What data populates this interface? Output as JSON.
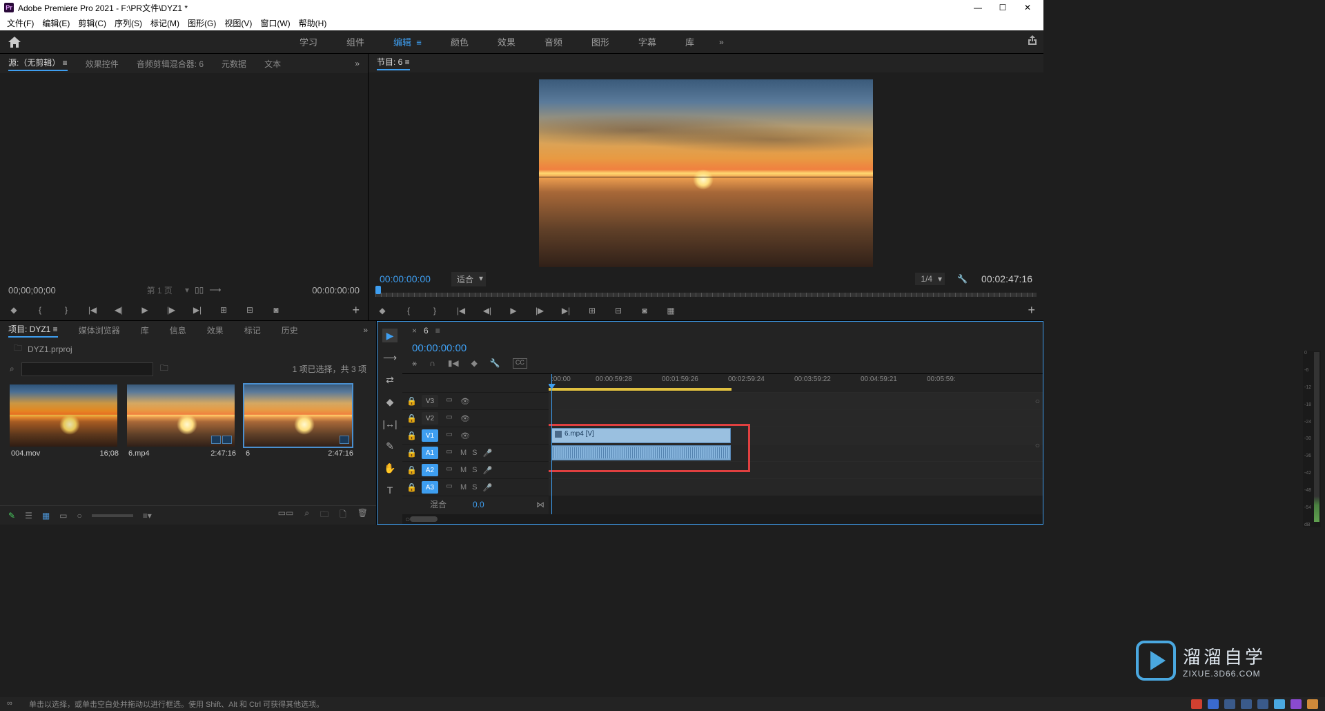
{
  "titlebar": {
    "app": "Adobe Premiere Pro 2021",
    "path": "F:\\PR文件\\DYZ1 *"
  },
  "menu": [
    "文件(F)",
    "编辑(E)",
    "剪辑(C)",
    "序列(S)",
    "标记(M)",
    "图形(G)",
    "视图(V)",
    "窗口(W)",
    "帮助(H)"
  ],
  "workspaces": {
    "items": [
      "学习",
      "组件",
      "编辑",
      "颜色",
      "效果",
      "音频",
      "图形",
      "字幕",
      "库"
    ],
    "active": "编辑",
    "more": "»"
  },
  "source": {
    "tabs": [
      "源:（无剪辑）",
      "效果控件",
      "音频剪辑混合器: 6",
      "元数据",
      "文本"
    ],
    "active": 0,
    "tc_left": "00;00;00;00",
    "page": "第 1 页",
    "tc_right": "00:00:00:00",
    "overflow": "»"
  },
  "program": {
    "tab": "节目: 6",
    "tc": "00:00:00:00",
    "fit": "适合",
    "resolution": "1/4",
    "duration": "00:02:47:16"
  },
  "project": {
    "tabs": [
      "项目: DYZ1",
      "媒体浏览器",
      "库",
      "信息",
      "效果",
      "标记",
      "历史"
    ],
    "active": 0,
    "overflow": "»",
    "file": "DYZ1.prproj",
    "search_placeholder": "",
    "sel_info": "1 项已选择，共 3 项",
    "bins": [
      {
        "name": "004.mov",
        "dur": "16;08",
        "selected": false,
        "seq": false
      },
      {
        "name": "6.mp4",
        "dur": "2:47:16",
        "selected": false,
        "seq": true
      },
      {
        "name": "6",
        "dur": "2:47:16",
        "selected": true,
        "seq": true
      }
    ]
  },
  "timeline": {
    "seq": "6",
    "tc": "00:00:00:00",
    "ruler": [
      ":00:00",
      "00:00:59:28",
      "00:01:59:26",
      "00:02:59:24",
      "00:03:59:22",
      "00:04:59:21",
      "00:05:59:"
    ],
    "tracks": {
      "video": [
        "V3",
        "V2",
        "V1"
      ],
      "audio": [
        "A1",
        "A2",
        "A3"
      ],
      "active_v": "V1",
      "active_a": [
        "A1",
        "A2",
        "A3"
      ]
    },
    "clip_label": "6.mp4 [V]",
    "mix": "混合",
    "mix_val": "0.0"
  },
  "meter": [
    "0",
    "-6",
    "-12",
    "-18",
    "-24",
    "-30",
    "-36",
    "-42",
    "-48",
    "-54",
    "dB"
  ],
  "status": "单击以选择，或单击空白处并拖动以进行框选。使用 Shift、Alt 和 Ctrl 可获得其他选项。",
  "watermark": {
    "main": "溜溜自学",
    "sub": "ZIXUE.3D66.COM"
  }
}
